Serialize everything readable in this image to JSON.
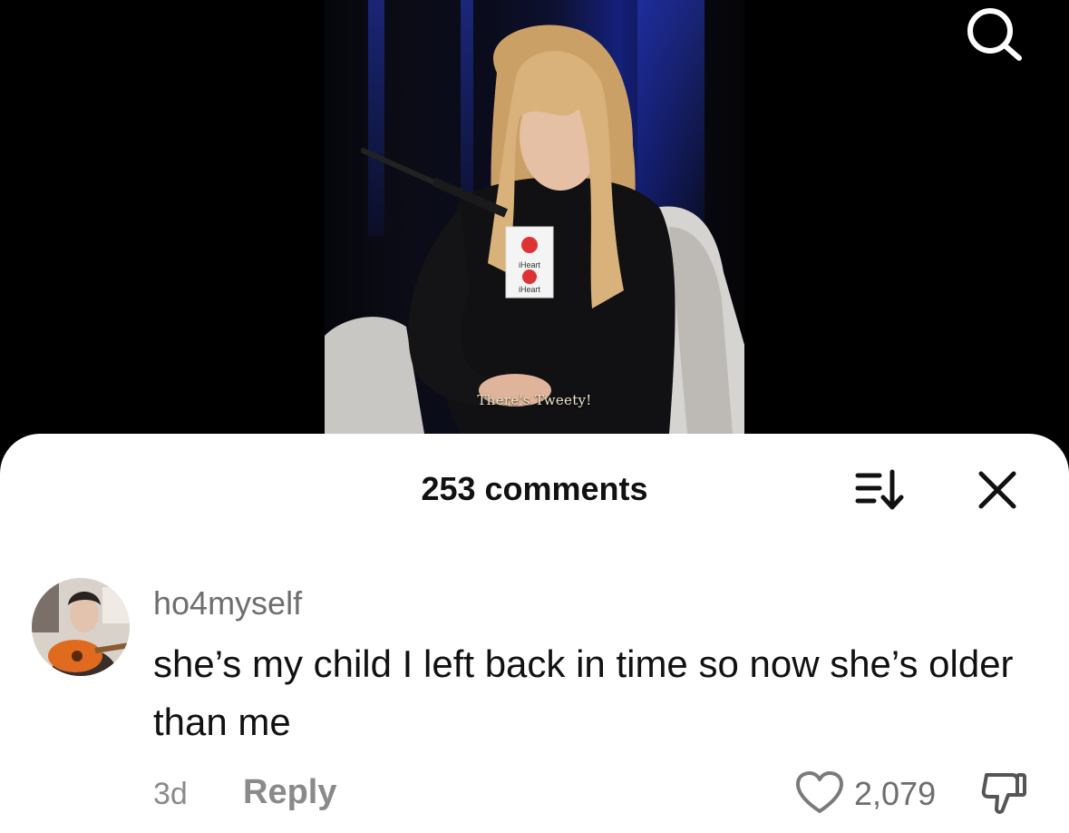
{
  "video": {
    "subtitle": "There's Tweety!",
    "mic_brand": "iHeart"
  },
  "header": {
    "search_icon": "search-icon"
  },
  "comments_sheet": {
    "count_label": "253 comments",
    "sort_icon": "sort-icon",
    "close_icon": "close-icon"
  },
  "comment": {
    "username": "ho4myself",
    "text": "she’s my child I left back in time so now she’s older than me",
    "time": "3d",
    "reply_label": "Reply",
    "likes": "2,079",
    "like_icon": "heart-icon",
    "dislike_icon": "thumbs-down-icon"
  },
  "colors": {
    "sheet_background": "#ffffff",
    "primary_text": "#111111",
    "secondary_text": "#8a8a8a",
    "subtitle_text": "#f1e9c8"
  }
}
